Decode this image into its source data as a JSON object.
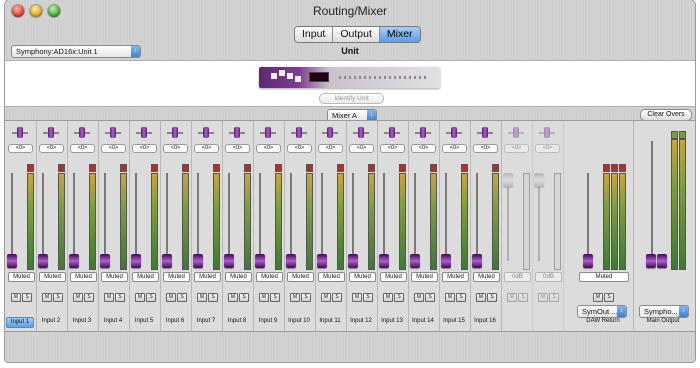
{
  "window": {
    "title": "Routing/Mixer"
  },
  "tabs": [
    {
      "label": "Input",
      "selected": false
    },
    {
      "label": "Output",
      "selected": false
    },
    {
      "label": "Mixer",
      "selected": true
    }
  ],
  "unit_section": {
    "label": "Unit",
    "device_select": "Symphony:AD16x:Unit 1",
    "identify_button": "Identify Unit"
  },
  "mixer": {
    "mixer_select": "Mixer A",
    "clear_overs_button": "Clear Overs",
    "pan_label": "<0>",
    "mute_button": "M",
    "solo_button": "S",
    "input_channels": [
      {
        "label": "Input 1",
        "mute_state": "Muted",
        "selected": true
      },
      {
        "label": "Input 2",
        "mute_state": "Muted"
      },
      {
        "label": "Input 3",
        "mute_state": "Muted"
      },
      {
        "label": "Input 4",
        "mute_state": "Muted"
      },
      {
        "label": "Input 5",
        "mute_state": "Muted"
      },
      {
        "label": "Input 6",
        "mute_state": "Muted"
      },
      {
        "label": "Input 7",
        "mute_state": "Muted"
      },
      {
        "label": "Input 8",
        "mute_state": "Muted"
      },
      {
        "label": "Input 9",
        "mute_state": "Muted"
      },
      {
        "label": "Input 10",
        "mute_state": "Muted"
      },
      {
        "label": "Input 11",
        "mute_state": "Muted"
      },
      {
        "label": "Input 12",
        "mute_state": "Muted"
      },
      {
        "label": "Input 13",
        "mute_state": "Muted"
      },
      {
        "label": "Input 14",
        "mute_state": "Muted"
      },
      {
        "label": "Input 15",
        "mute_state": "Muted"
      },
      {
        "label": "Input 16",
        "mute_state": "Muted"
      }
    ],
    "inactive_channels": [
      {
        "gain": "0dB"
      },
      {
        "gain": "0dB"
      }
    ],
    "daw_return": {
      "label": "DAW Return",
      "mute_state": "Muted",
      "select": "SymOut ..."
    },
    "main_output": {
      "label": "Main Output",
      "select": "Sympho..."
    }
  },
  "colors": {
    "accent": "#9b3fbf",
    "selection": "#5b9ee6"
  }
}
